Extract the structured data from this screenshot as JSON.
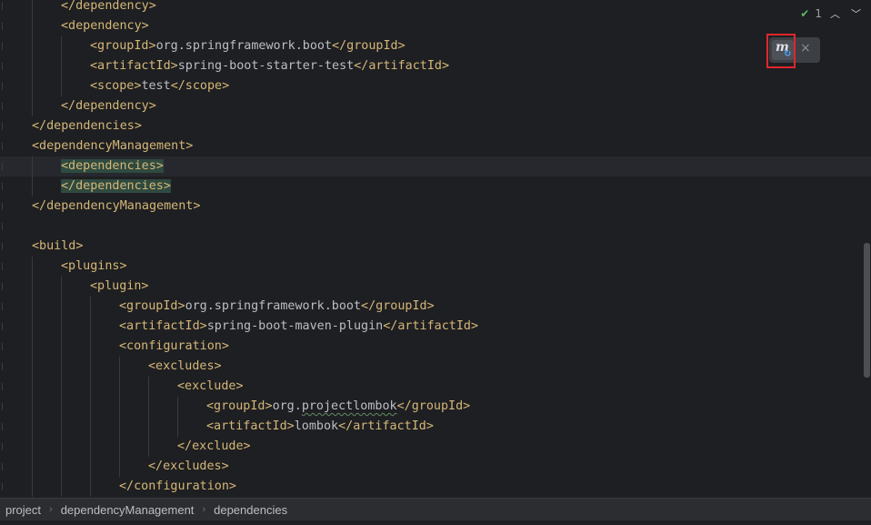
{
  "lines": [
    [
      {
        "t": "</dependency>",
        "c": "tag"
      }
    ],
    [
      {
        "t": "<dependency>",
        "c": "tag"
      }
    ],
    [
      {
        "t": "<groupId>",
        "c": "tag"
      },
      {
        "t": "org.springframework.boot",
        "c": "txt"
      },
      {
        "t": "</groupId>",
        "c": "tag"
      }
    ],
    [
      {
        "t": "<artifactId>",
        "c": "tag"
      },
      {
        "t": "spring-boot-starter-test",
        "c": "txt"
      },
      {
        "t": "</artifactId>",
        "c": "tag"
      }
    ],
    [
      {
        "t": "<scope>",
        "c": "tag"
      },
      {
        "t": "test",
        "c": "txt"
      },
      {
        "t": "</scope>",
        "c": "tag"
      }
    ],
    [
      {
        "t": "</dependency>",
        "c": "tag"
      }
    ],
    [
      {
        "t": "</dependencies>",
        "c": "tag"
      }
    ],
    [
      {
        "t": "<dependencyManagement>",
        "c": "tag"
      }
    ],
    [
      {
        "t": "<dependencies>",
        "c": "tag hl"
      }
    ],
    [
      {
        "t": "</dependencies>",
        "c": "tag hl"
      }
    ],
    [
      {
        "t": "</dependencyManagement>",
        "c": "tag"
      }
    ],
    [],
    [
      {
        "t": "<build>",
        "c": "tag"
      }
    ],
    [
      {
        "t": "<plugins>",
        "c": "tag"
      }
    ],
    [
      {
        "t": "<plugin>",
        "c": "tag"
      }
    ],
    [
      {
        "t": "<groupId>",
        "c": "tag"
      },
      {
        "t": "org.springframework.boot",
        "c": "txt"
      },
      {
        "t": "</groupId>",
        "c": "tag"
      }
    ],
    [
      {
        "t": "<artifactId>",
        "c": "tag"
      },
      {
        "t": "spring-boot-maven-plugin",
        "c": "txt"
      },
      {
        "t": "</artifactId>",
        "c": "tag"
      }
    ],
    [
      {
        "t": "<configuration>",
        "c": "tag"
      }
    ],
    [
      {
        "t": "<excludes>",
        "c": "tag"
      }
    ],
    [
      {
        "t": "<exclude>",
        "c": "tag"
      }
    ],
    [
      {
        "t": "<groupId>",
        "c": "tag"
      },
      {
        "t": "org.",
        "c": "txt"
      },
      {
        "t": "projectlombok",
        "c": "txt squig"
      },
      {
        "t": "</groupId>",
        "c": "tag"
      }
    ],
    [
      {
        "t": "<artifactId>",
        "c": "tag"
      },
      {
        "t": "lombok",
        "c": "txt"
      },
      {
        "t": "</artifactId>",
        "c": "tag"
      }
    ],
    [
      {
        "t": "</exclude>",
        "c": "tag"
      }
    ],
    [
      {
        "t": "</excludes>",
        "c": "tag"
      }
    ],
    [
      {
        "t": "</configuration>",
        "c": "tag"
      }
    ]
  ],
  "inspection": {
    "count": "1",
    "up_icon": "chevron-up",
    "down_icon": "chevron-down",
    "status_icon": "check-double"
  },
  "popup": {
    "maven_icon": "maven-reload",
    "close_symbol": "×"
  },
  "breadcrumbs": [
    "project",
    "dependencyManagement",
    "dependencies"
  ],
  "colors": {
    "background": "#1e1f22",
    "tag": "#d5b778",
    "text": "#bcbec4",
    "match_highlight": "#2f4a3f",
    "annotation": "#e0262c"
  }
}
